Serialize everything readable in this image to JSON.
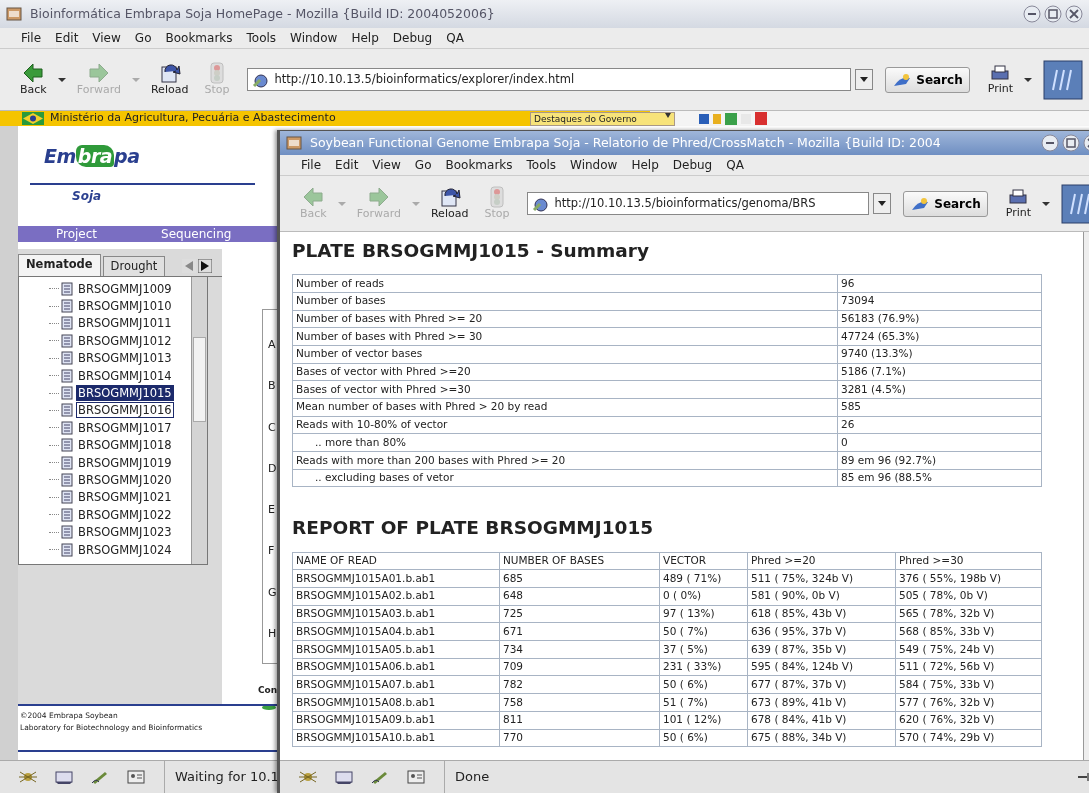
{
  "back_window": {
    "title": "Bioinformática Embrapa Soja HomePage - Mozilla {Build ID: 2004052006}",
    "menu": [
      "File",
      "Edit",
      "View",
      "Go",
      "Bookmarks",
      "Tools",
      "Window",
      "Help",
      "Debug",
      "QA"
    ],
    "nav_buttons": [
      {
        "label": "Back",
        "disabled": false
      },
      {
        "label": "Forward",
        "disabled": true
      },
      {
        "label": "Reload",
        "disabled": false
      },
      {
        "label": "Stop",
        "disabled": true
      }
    ],
    "url": "http://10.10.13.5/bioinformatics/explorer/index.html",
    "search_label": "Search",
    "print_label": "Print",
    "gov_bar": {
      "ministry": "Ministério da Agricultura, Pecuária e Abastecimento",
      "dropdown": "Destaques do Governo"
    },
    "logo_parts": [
      "Em",
      "bra",
      "pa"
    ],
    "logo_subtitle": "Soja",
    "nav_links": [
      "Project",
      "Sequencing"
    ],
    "tabs": [
      {
        "label": "Nematode",
        "selected": true
      },
      {
        "label": "Drought",
        "selected": false
      }
    ],
    "tree_items": [
      {
        "label": "BRSOGMMJ1009",
        "selected": false,
        "focused": false
      },
      {
        "label": "BRSOGMMJ1010",
        "selected": false,
        "focused": false
      },
      {
        "label": "BRSOGMMJ1011",
        "selected": false,
        "focused": false
      },
      {
        "label": "BRSOGMMJ1012",
        "selected": false,
        "focused": false
      },
      {
        "label": "BRSOGMMJ1013",
        "selected": false,
        "focused": false
      },
      {
        "label": "BRSOGMMJ1014",
        "selected": false,
        "focused": false
      },
      {
        "label": "BRSOGMMJ1015",
        "selected": true,
        "focused": false
      },
      {
        "label": "BRSOGMMJ1016",
        "selected": false,
        "focused": true
      },
      {
        "label": "BRSOGMMJ1017",
        "selected": false,
        "focused": false
      },
      {
        "label": "BRSOGMMJ1018",
        "selected": false,
        "focused": false
      },
      {
        "label": "BRSOGMMJ1019",
        "selected": false,
        "focused": false
      },
      {
        "label": "BRSOGMMJ1020",
        "selected": false,
        "focused": false
      },
      {
        "label": "BRSOGMMJ1021",
        "selected": false,
        "focused": false
      },
      {
        "label": "BRSOGMMJ1022",
        "selected": false,
        "focused": false
      },
      {
        "label": "BRSOGMMJ1023",
        "selected": false,
        "focused": false
      },
      {
        "label": "BRSOGMMJ1024",
        "selected": false,
        "focused": false
      }
    ],
    "row_labels": [
      "A",
      "B",
      "C",
      "D",
      "E",
      "F",
      "G",
      "H"
    ],
    "cut_label": "Con",
    "footer": [
      "©2004 Embrapa Soybean",
      "Laboratory for Biotechnology and Bioinformatics"
    ],
    "status": "Waiting for 10.1"
  },
  "front_window": {
    "title": "Soybean Functional Genome Embrapa Soja - Relatorio de Phred/CrossMatch - Mozilla {Build ID: 2004",
    "menu": [
      "File",
      "Edit",
      "View",
      "Go",
      "Bookmarks",
      "Tools",
      "Window",
      "Help",
      "Debug",
      "QA"
    ],
    "nav_buttons": [
      {
        "label": "Back",
        "disabled": true
      },
      {
        "label": "Forward",
        "disabled": true
      },
      {
        "label": "Reload",
        "disabled": false
      },
      {
        "label": "Stop",
        "disabled": true
      }
    ],
    "url": "http://10.10.13.5/bioinformatics/genoma/BRS",
    "search_label": "Search",
    "print_label": "Print",
    "summary": {
      "title": "PLATE BRSOGMMJ1015 - Summary",
      "rows": [
        {
          "label": "Number of reads",
          "value": "96",
          "indented": false
        },
        {
          "label": "Number of bases",
          "value": "73094",
          "indented": false
        },
        {
          "label": "Number of bases with Phred >= 20",
          "value": "56183 (76.9%)",
          "indented": false
        },
        {
          "label": "Number of bases with Phred >= 30",
          "value": "47724 (65.3%)",
          "indented": false
        },
        {
          "label": "Number of vector bases",
          "value": "9740 (13.3%)",
          "indented": false
        },
        {
          "label": "Bases of vector with Phred >=20",
          "value": "5186 (7.1%)",
          "indented": false
        },
        {
          "label": "Bases of vector with Phred >=30",
          "value": "3281 (4.5%)",
          "indented": false
        },
        {
          "label": "Mean number of bases with Phred > 20 by read",
          "value": "585",
          "indented": false
        },
        {
          "label": "Reads with 10-80% of vector",
          "value": "26",
          "indented": false
        },
        {
          "label": ".. more than 80%",
          "value": "0",
          "indented": true
        },
        {
          "label": "Reads with more than 200 bases with Phred >= 20",
          "value": "89 em 96 (92.7%)",
          "indented": false
        },
        {
          "label": ".. excluding bases of vetor",
          "value": "85 em 96 (88.5%",
          "indented": true
        }
      ]
    },
    "report": {
      "title": "REPORT OF PLATE BRSOGMMJ1015",
      "columns": [
        "NAME OF READ",
        "NUMBER OF BASES",
        "VECTOR",
        "Phred >=20",
        "Phred >=30"
      ],
      "rows": [
        [
          "BRSOGMMJ1015A01.b.ab1",
          "685",
          "489 ( 71%)",
          "511 ( 75%, 324b V)",
          "376 ( 55%, 198b V)"
        ],
        [
          "BRSOGMMJ1015A02.b.ab1",
          "648",
          "0 ( 0%)",
          "581 ( 90%, 0b V)",
          "505 ( 78%, 0b V)"
        ],
        [
          "BRSOGMMJ1015A03.b.ab1",
          "725",
          "97 ( 13%)",
          "618 ( 85%, 43b V)",
          "565 ( 78%, 32b V)"
        ],
        [
          "BRSOGMMJ1015A04.b.ab1",
          "671",
          "50 ( 7%)",
          "636 ( 95%, 37b V)",
          "568 ( 85%, 33b V)"
        ],
        [
          "BRSOGMMJ1015A05.b.ab1",
          "734",
          "37 ( 5%)",
          "639 ( 87%, 35b V)",
          "549 ( 75%, 24b V)"
        ],
        [
          "BRSOGMMJ1015A06.b.ab1",
          "709",
          "231 ( 33%)",
          "595 ( 84%, 124b V)",
          "511 ( 72%, 56b V)"
        ],
        [
          "BRSOGMMJ1015A07.b.ab1",
          "782",
          "50 ( 6%)",
          "677 ( 87%, 37b V)",
          "584 ( 75%, 33b V)"
        ],
        [
          "BRSOGMMJ1015A08.b.ab1",
          "758",
          "51 ( 7%)",
          "673 ( 89%, 41b V)",
          "577 ( 76%, 32b V)"
        ],
        [
          "BRSOGMMJ1015A09.b.ab1",
          "811",
          "101 ( 12%)",
          "678 ( 84%, 41b V)",
          "620 ( 76%, 32b V)"
        ],
        [
          "BRSOGMMJ1015A10.b.ab1",
          "770",
          "50 ( 6%)",
          "675 ( 88%, 34b V)",
          "570 ( 74%, 29b V)"
        ]
      ]
    },
    "status": "Done"
  }
}
